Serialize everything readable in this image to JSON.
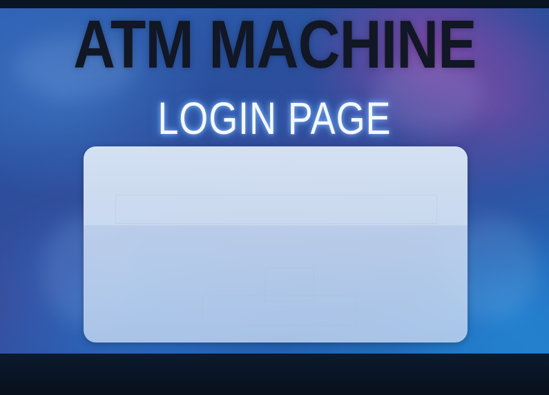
{
  "header": {
    "title": "ATM MACHINE",
    "subtitle": "LOGIN PAGE"
  },
  "colors": {
    "title": "#111724",
    "subtitle": "#f4f8ff",
    "subtitle_glow": "#5aa0ff",
    "card": "#d6e4f5",
    "background_blue": "#2f62b5",
    "background_purple": "#9646aa",
    "frame": "#06101c"
  }
}
